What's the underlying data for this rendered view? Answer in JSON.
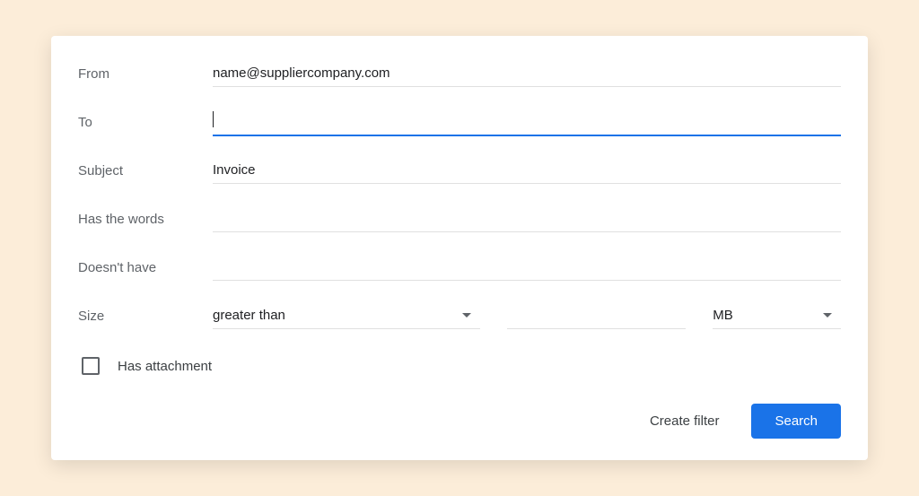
{
  "form": {
    "from": {
      "label": "From",
      "value": "name@suppliercompany.com"
    },
    "to": {
      "label": "To",
      "value": ""
    },
    "subject": {
      "label": "Subject",
      "value": "Invoice"
    },
    "hasWords": {
      "label": "Has the words",
      "value": ""
    },
    "doesntHave": {
      "label": "Doesn't have",
      "value": ""
    },
    "size": {
      "label": "Size",
      "operator": "greater than",
      "value": "",
      "unit": "MB"
    },
    "hasAttachment": {
      "label": "Has attachment",
      "checked": false
    }
  },
  "footer": {
    "createFilter": "Create filter",
    "search": "Search"
  }
}
